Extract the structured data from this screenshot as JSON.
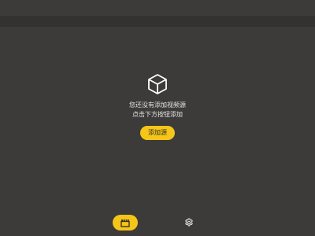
{
  "empty_state": {
    "icon": "box-icon",
    "line1": "您还没有添加视频源",
    "line2": "点击下方按钮添加",
    "button_label": "添加源"
  },
  "bottom_nav": {
    "items": [
      {
        "icon": "clapperboard-icon",
        "active": true
      },
      {
        "icon": "gear-icon",
        "active": false
      }
    ]
  },
  "colors": {
    "background": "#3c3b3a",
    "toolbar": "#333231",
    "accent": "#f5c518",
    "text": "#e8e6e3"
  }
}
